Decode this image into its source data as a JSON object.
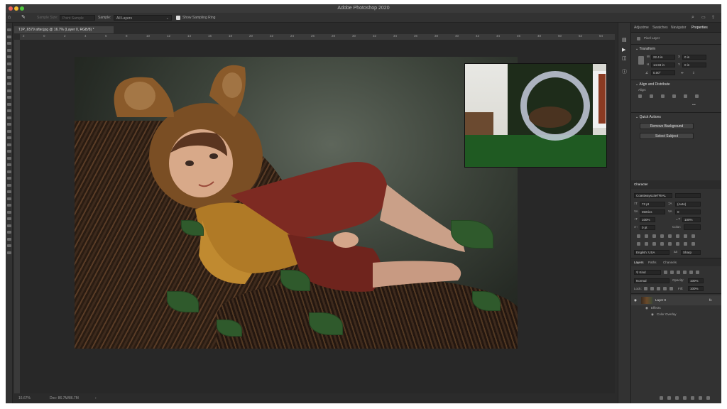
{
  "window": {
    "title": "Adobe Photoshop 2020"
  },
  "options_bar": {
    "sample_size_label": "Sample Size:",
    "sample_size_value": "Point Sample",
    "sample_label": "Sample:",
    "sample_value": "All Layers",
    "show_ring_label": "Show Sampling Ring"
  },
  "document": {
    "tab_title": "TJP_6579 after.jpg @ 16.7% (Layer 0, RGB/8) *"
  },
  "ruler_ticks": [
    "2",
    "0",
    "2",
    "4",
    "6",
    "8",
    "10",
    "12",
    "14",
    "16",
    "18",
    "20",
    "22",
    "24",
    "26",
    "28",
    "30",
    "32",
    "34",
    "36",
    "38",
    "40",
    "42",
    "44",
    "46",
    "48",
    "50",
    "52",
    "54",
    "56"
  ],
  "status": {
    "zoom": "16.67%",
    "doc_size": "Doc: 86.7M/86.7M"
  },
  "properties_panel": {
    "tabs": [
      "Adjustme",
      "Swatches",
      "Navigator",
      "Properties"
    ],
    "active_tab": "Properties",
    "layer_type": "Pixel Layer",
    "transform": {
      "title": "Transform",
      "w_label": "W",
      "w_value": "22.4 in",
      "h_label": "H",
      "h_value": "14.93 in",
      "x_label": "X",
      "x_value": "0 in",
      "y_label": "Y",
      "y_value": "0 in",
      "angle_value": "0.00°"
    },
    "align": {
      "title": "Align and Distribute",
      "subtitle": "Align:"
    },
    "quick_actions": {
      "title": "Quick Actions",
      "remove_bg": "Remove Background",
      "select_subject": "Select Subject"
    }
  },
  "character_panel": {
    "title": "Character",
    "font_family": "CoastwaysLiteTRIAL",
    "font_size": "72 pt",
    "leading": "(Auto)",
    "kerning": "Metrics",
    "tracking": "0",
    "vertical_scale": "100%",
    "horizontal_scale": "100%",
    "baseline": "0 pt",
    "color_label": "Color:",
    "language": "English: USA",
    "aa_label": "aa",
    "antialias": "Sharp"
  },
  "layers_panel": {
    "tabs": [
      "Layers",
      "Paths",
      "Channels"
    ],
    "active_tab": "Layers",
    "filter_kind": "Kind",
    "blend_mode": "Normal",
    "opacity_label": "Opacity:",
    "opacity": "100%",
    "lock_label": "Lock:",
    "fill_label": "Fill:",
    "fill": "100%",
    "layers": [
      {
        "name": "Layer 0",
        "fx": "fx"
      },
      {
        "name": "Effects"
      },
      {
        "name": "Color Overlay"
      }
    ]
  }
}
